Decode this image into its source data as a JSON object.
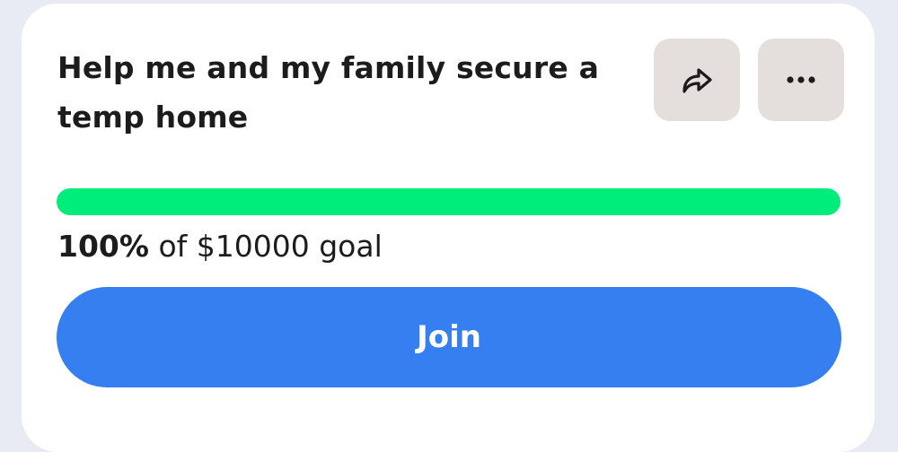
{
  "campaign": {
    "title": "Help me and my family secure a temp home",
    "progress_percent_label": "100%",
    "progress_fraction": 1.0,
    "goal_text": " of $10000 goal"
  },
  "actions": {
    "share_icon": "share-arrow-icon",
    "more_icon": "ellipsis-icon",
    "more_glyph": "•••",
    "join_label": "Join"
  },
  "colors": {
    "progress": "#00ec7b",
    "join_button": "#357ff0",
    "icon_button_bg": "#e4dedd"
  }
}
